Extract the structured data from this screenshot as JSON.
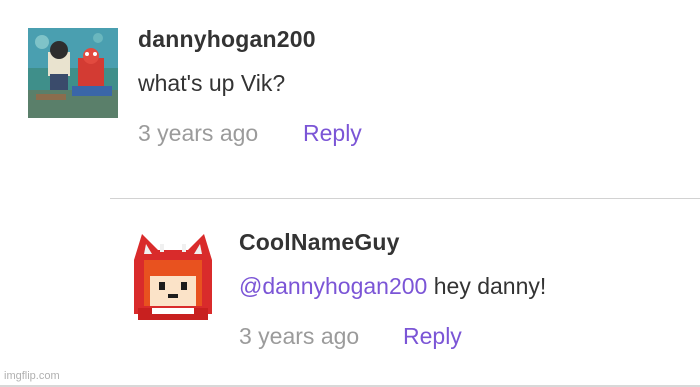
{
  "comments": [
    {
      "username": "dannyhogan200",
      "text": "what's up Vik?",
      "time": "3 years ago",
      "reply_label": "Reply",
      "avatar_icon": "cartoon-avatar-icon"
    },
    {
      "username": "CoolNameGuy",
      "mention": "@dannyhogan200",
      "text": " hey danny!",
      "time": "3 years ago",
      "reply_label": "Reply",
      "avatar_icon": "red-hood-character-avatar-icon"
    }
  ],
  "watermark": "imgflip.com",
  "colors": {
    "link": "#7b55d6",
    "text": "#333333",
    "muted": "#9b9b9b"
  }
}
